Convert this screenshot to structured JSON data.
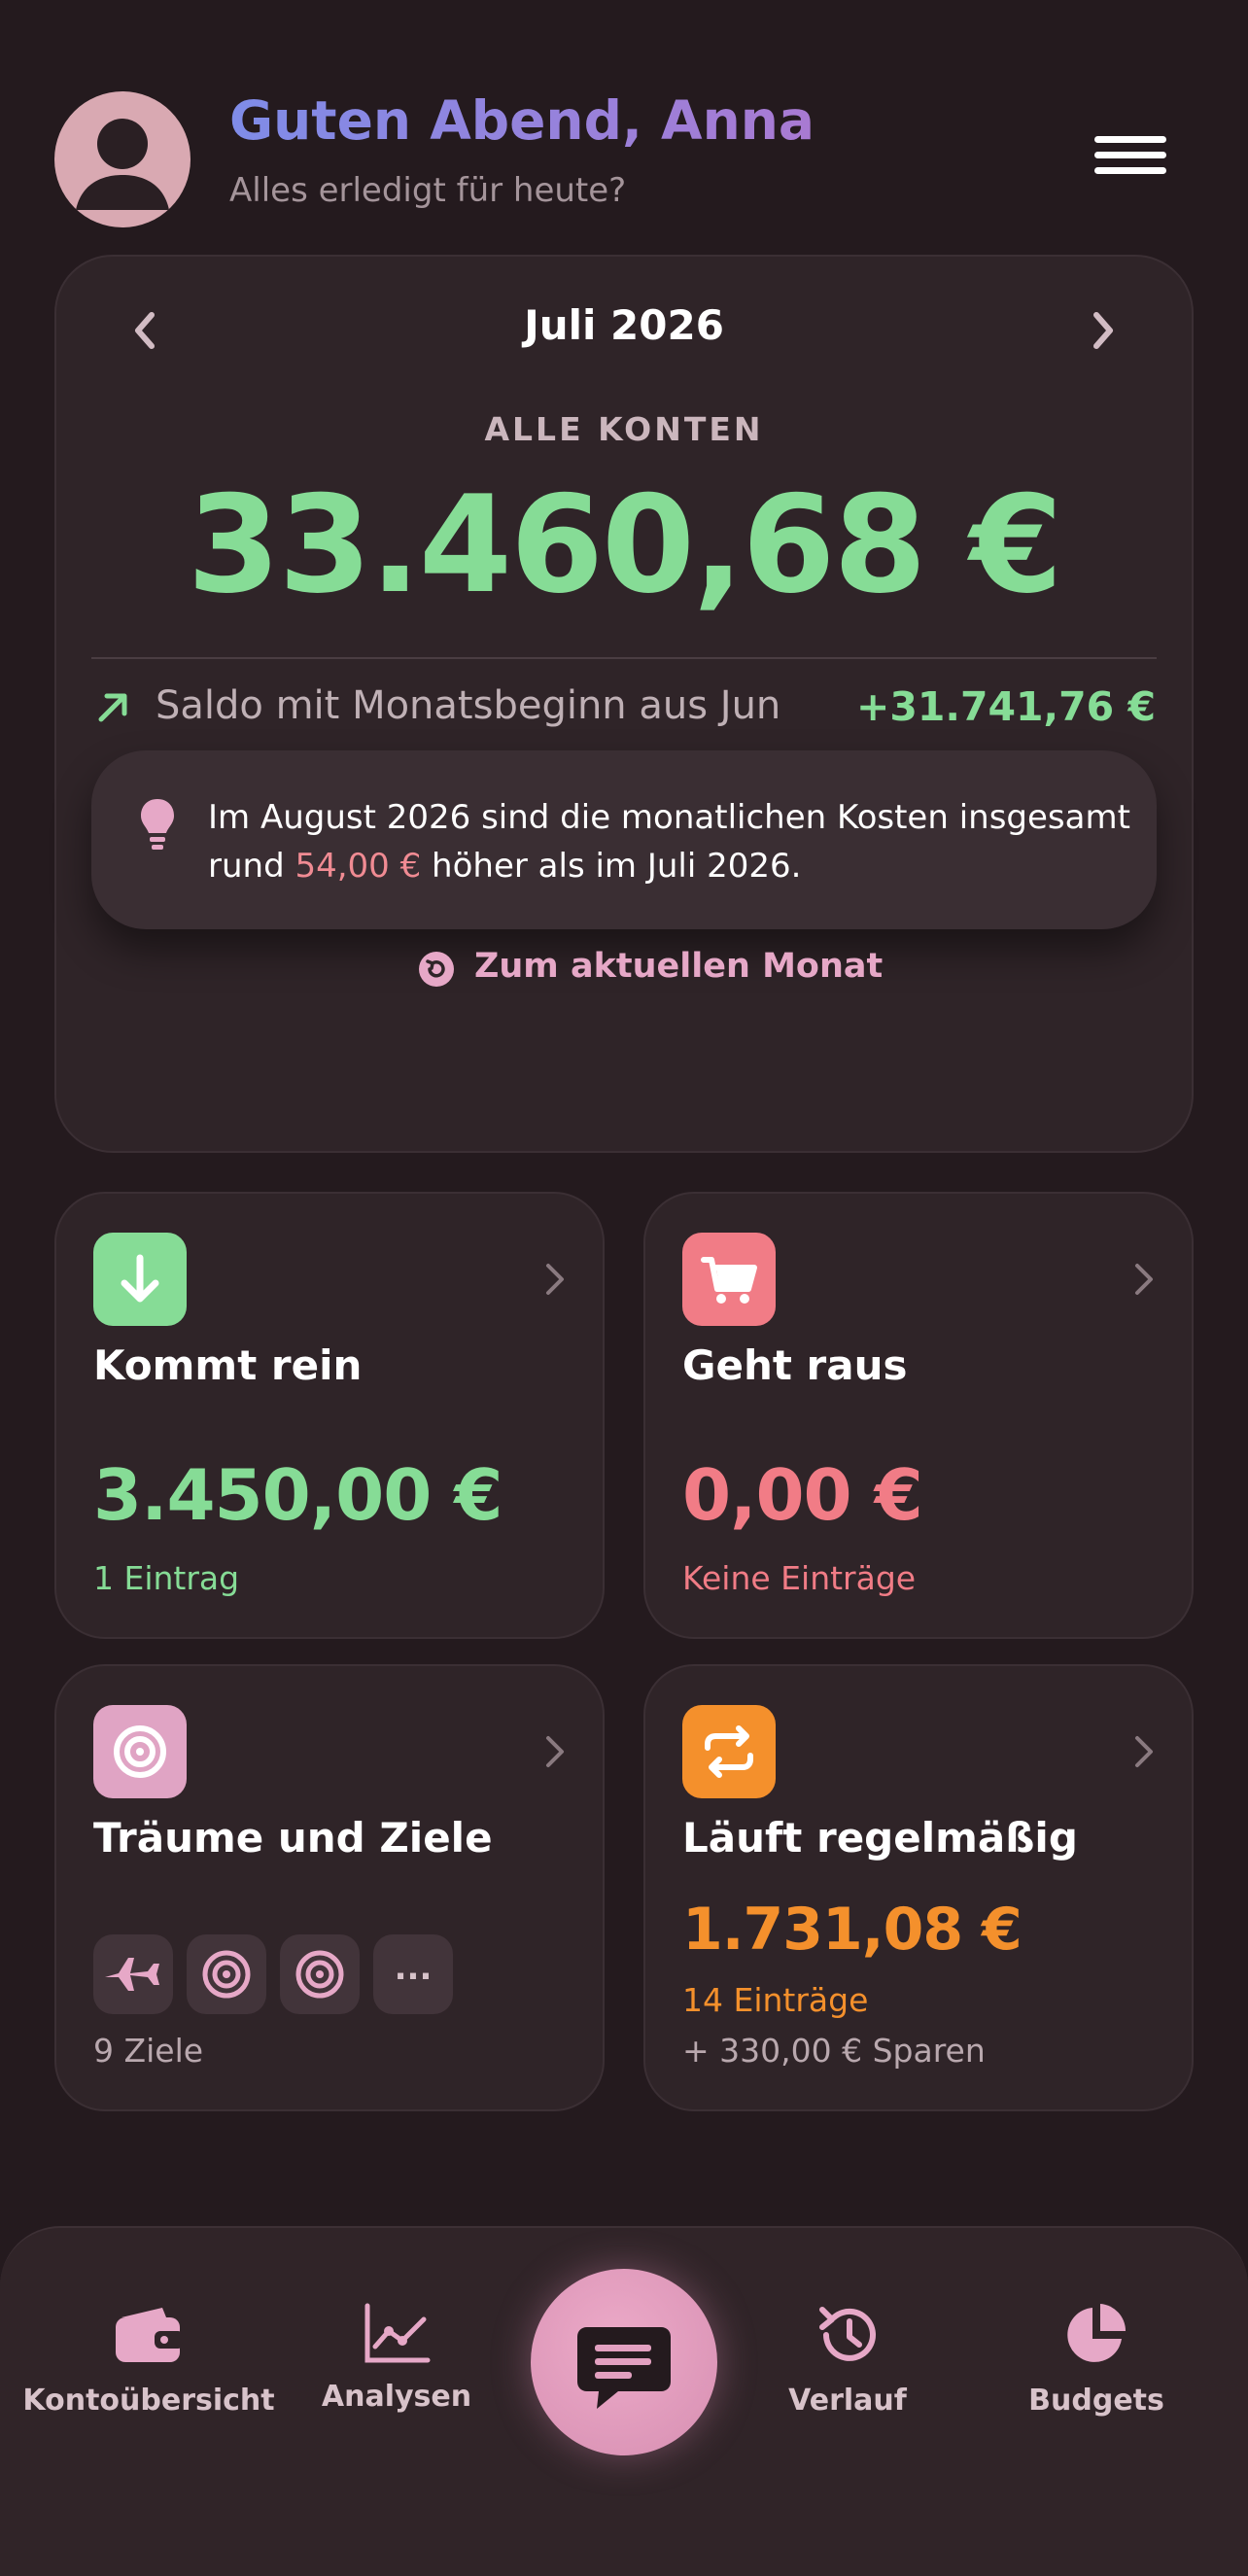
{
  "header": {
    "greeting": "Guten Abend, Anna",
    "subtitle": "Alles erledigt für heute?"
  },
  "overview": {
    "month": "Juli 2026",
    "accounts_label": "ALLE KONTEN",
    "total": "33.460,68 €",
    "saldo_label": "Saldo mit Monatsbeginn aus Jun",
    "saldo_value": "+31.741,76 €",
    "tip_part1": "Im August 2026 sind die monatlichen Kosten insgesamt rund ",
    "tip_amount": "54,00 €",
    "tip_part2": " höher als im Juli 2026.",
    "today_link": "Zum aktuellen Monat"
  },
  "tiles": {
    "income": {
      "title": "Kommt rein",
      "amount": "3.450,00 €",
      "sub": "1 Eintrag",
      "color": "#86dc96"
    },
    "expenses": {
      "title": "Geht raus",
      "amount": "0,00 €",
      "sub": "Keine Einträge",
      "color": "#f17c86"
    },
    "goals": {
      "title": "Träume und Ziele",
      "more": "...",
      "sub": "9 Ziele",
      "icons": [
        "airplane-icon",
        "target-icon",
        "target-icon"
      ]
    },
    "recurring": {
      "title": "Läuft regelmäßig",
      "amount": "1.731,08 €",
      "sub": "14 Einträge",
      "sub2": "+ 330,00 € Sparen",
      "color": "#f4902c"
    }
  },
  "nav": {
    "items": [
      {
        "label": "Kontoübersicht",
        "icon": "wallet-icon"
      },
      {
        "label": "Analysen",
        "icon": "chart-line-icon"
      },
      {
        "label": "Chat",
        "icon": "chat-icon"
      },
      {
        "label": "Verlauf",
        "icon": "history-icon"
      },
      {
        "label": "Budgets",
        "icon": "pie-chart-icon"
      }
    ]
  },
  "colors": {
    "background": "#241a1e",
    "card": "#2f2428",
    "positive": "#86dc96",
    "negative": "#f17c86",
    "accent": "#e6a8c7",
    "orange": "#f4902c"
  }
}
